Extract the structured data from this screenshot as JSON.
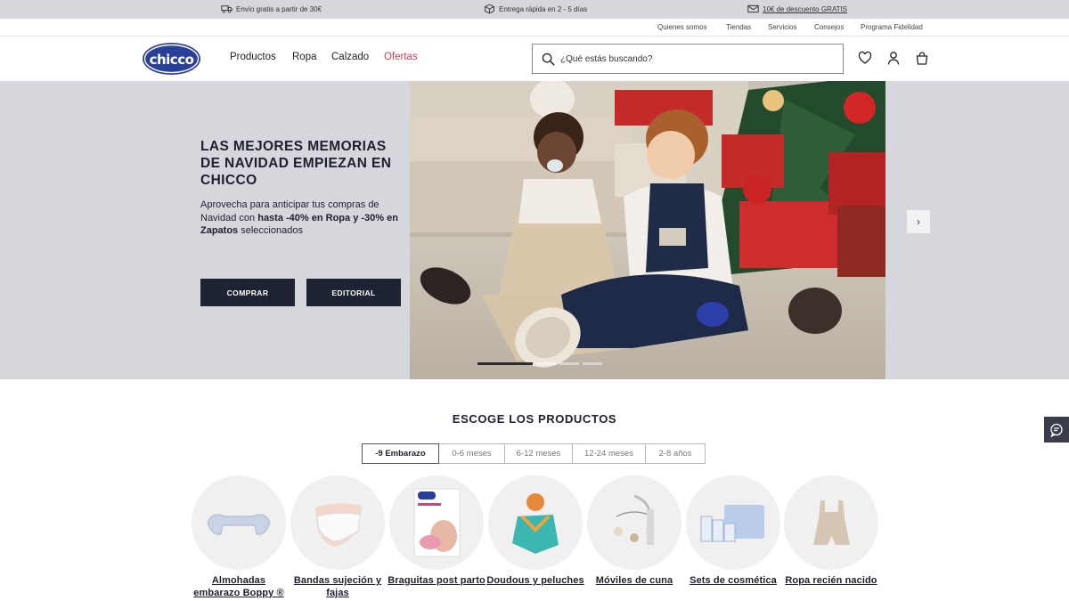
{
  "promo": {
    "shipping": "Envío gratis a partir de 30€",
    "delivery": "Entrega rápida en 2 - 5 días",
    "discount": "10€ de descuento GRATIS"
  },
  "utility_links": [
    "Quienes somos",
    "Tiendas",
    "Servicios",
    "Consejos",
    "Programa Fidelidad"
  ],
  "logo_text": "chicco",
  "nav": [
    "Productos",
    "Ropa",
    "Calzado",
    "Ofertas"
  ],
  "search": {
    "placeholder": "¿Qué estás buscando?"
  },
  "hero": {
    "title": "LAS MEJORES MEMORIAS DE NAVIDAD EMPIEZAN EN CHICCO",
    "text_pre": "Aprovecha para anticipar tus compras de Navidad con ",
    "text_bold1": "hasta -40% en Ropa y -30% en Zapatos",
    "text_post": " seleccionados",
    "buttons": [
      "COMPRAR",
      "EDITORIAL"
    ],
    "next_arrow": "›",
    "slides": {
      "total": 4,
      "active": 1
    }
  },
  "products": {
    "title": "ESCOGE LOS PRODUCTOS",
    "tabs": [
      "-9 Embarazo",
      "0-6 meses",
      "6-12 meses",
      "12-24 meses",
      "2-8 años"
    ],
    "active_tab": 0,
    "categories": [
      {
        "label": "Almohadas embarazo Boppy ®",
        "icon": "pillow-icon"
      },
      {
        "label": "Bandas sujeción y fajas",
        "icon": "belt-icon"
      },
      {
        "label": "Braguitas post parto",
        "icon": "briefs-box-icon"
      },
      {
        "label": "Doudous y peluches",
        "icon": "doudou-icon"
      },
      {
        "label": "Móviles de cuna",
        "icon": "crib-mobile-icon"
      },
      {
        "label": "Sets de cosmética",
        "icon": "cosmetics-set-icon"
      },
      {
        "label": "Ropa recién nacido",
        "icon": "romper-icon"
      }
    ]
  },
  "colors": {
    "promo_bg": "#d6d7dc",
    "hero_bg": "#d6d7dc",
    "button_bg": "#1d2333",
    "sale_link": "#cc3d59",
    "logo_blue": "#2a3f97"
  }
}
